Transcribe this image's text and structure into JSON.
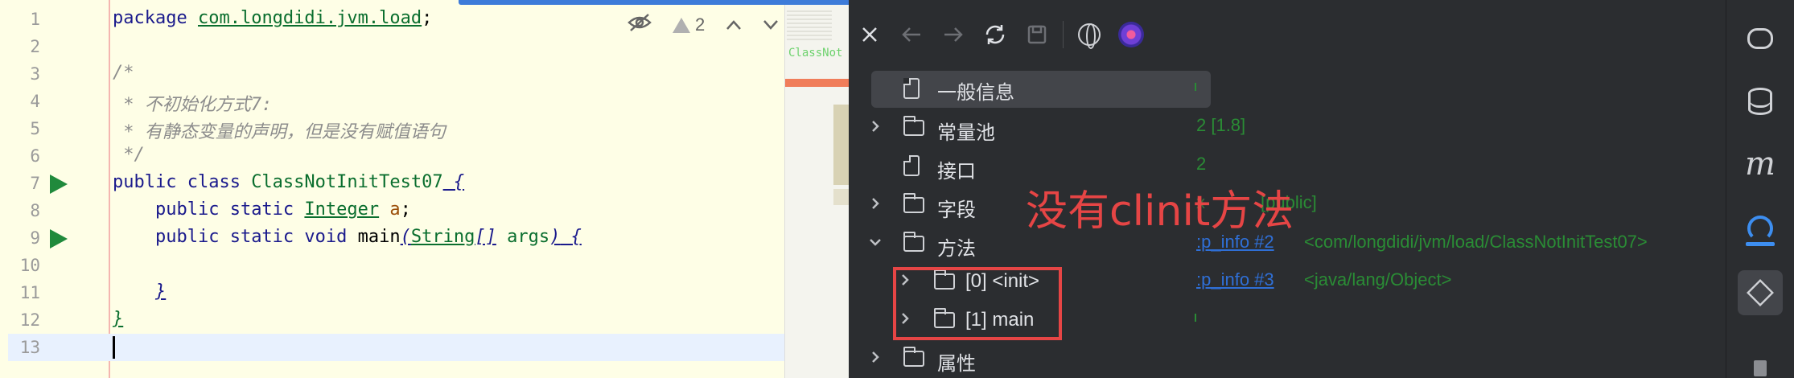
{
  "editor": {
    "lines": [
      {
        "num": "1",
        "text_kw": "package ",
        "text_pkg": "com.longdidi.jvm.load",
        "text_tail": ";"
      },
      {
        "num": "2"
      },
      {
        "num": "3",
        "comment": "/*"
      },
      {
        "num": "4",
        "comment": " * 不初始化方式7:"
      },
      {
        "num": "5",
        "comment": " * 有静态变量的声明，但是没有赋值语句"
      },
      {
        "num": "6",
        "comment": " */"
      },
      {
        "num": "7",
        "kw": "public class ",
        "cls": "ClassNotInitTest07",
        "tail": " {"
      },
      {
        "num": "8",
        "indent": "    ",
        "kw": "public static ",
        "typ": "Integer",
        "sp": " ",
        "fld": "a",
        "tail": ";"
      },
      {
        "num": "9",
        "indent": "    ",
        "kw": "public static void ",
        "name": "main",
        "p1": "(",
        "typ": "String",
        "arr": "[]",
        "args": " args",
        "p2": ")",
        "tail": " {"
      },
      {
        "num": "10"
      },
      {
        "num": "11",
        "indent": "    ",
        "brace": "}"
      },
      {
        "num": "12",
        "brace": "}"
      },
      {
        "num": "13"
      }
    ],
    "warning_count": "2",
    "minimap_label": "ClassNot"
  },
  "panel": {
    "tree": [
      {
        "label": "一般信息",
        "icon": "file-icon",
        "selected": true
      },
      {
        "label": "常量池",
        "icon": "folder-icon",
        "expandable": true
      },
      {
        "label": "接口",
        "icon": "file-icon"
      },
      {
        "label": "字段",
        "icon": "folder-icon",
        "expandable": true
      },
      {
        "label": "方法",
        "icon": "folder-icon",
        "expanded": true
      },
      {
        "label": "[0] <init>",
        "icon": "folder-icon",
        "expandable": true,
        "child": true
      },
      {
        "label": "[1] main",
        "icon": "folder-icon",
        "expandable": true,
        "child": true
      },
      {
        "label": "属性",
        "icon": "folder-icon",
        "expandable": true
      }
    ],
    "values": {
      "row1": "2 [1.8]",
      "row2": "2",
      "row3": "[public]",
      "row3_prefix": "x",
      "link1": ":p_info #2",
      "ref1": "<com/longdidi/jvm/load/ClassNotInitTest07>",
      "link2": ":p_info #3",
      "ref2": "<java/lang/Object>"
    },
    "annotation": "没有clinit方法"
  },
  "colors": {
    "editor_bg": "#fefee6",
    "panel_bg": "#2b2d30",
    "annotation": "#e64545",
    "value_green": "#2a8c35",
    "link_blue": "#2f6fd6"
  }
}
